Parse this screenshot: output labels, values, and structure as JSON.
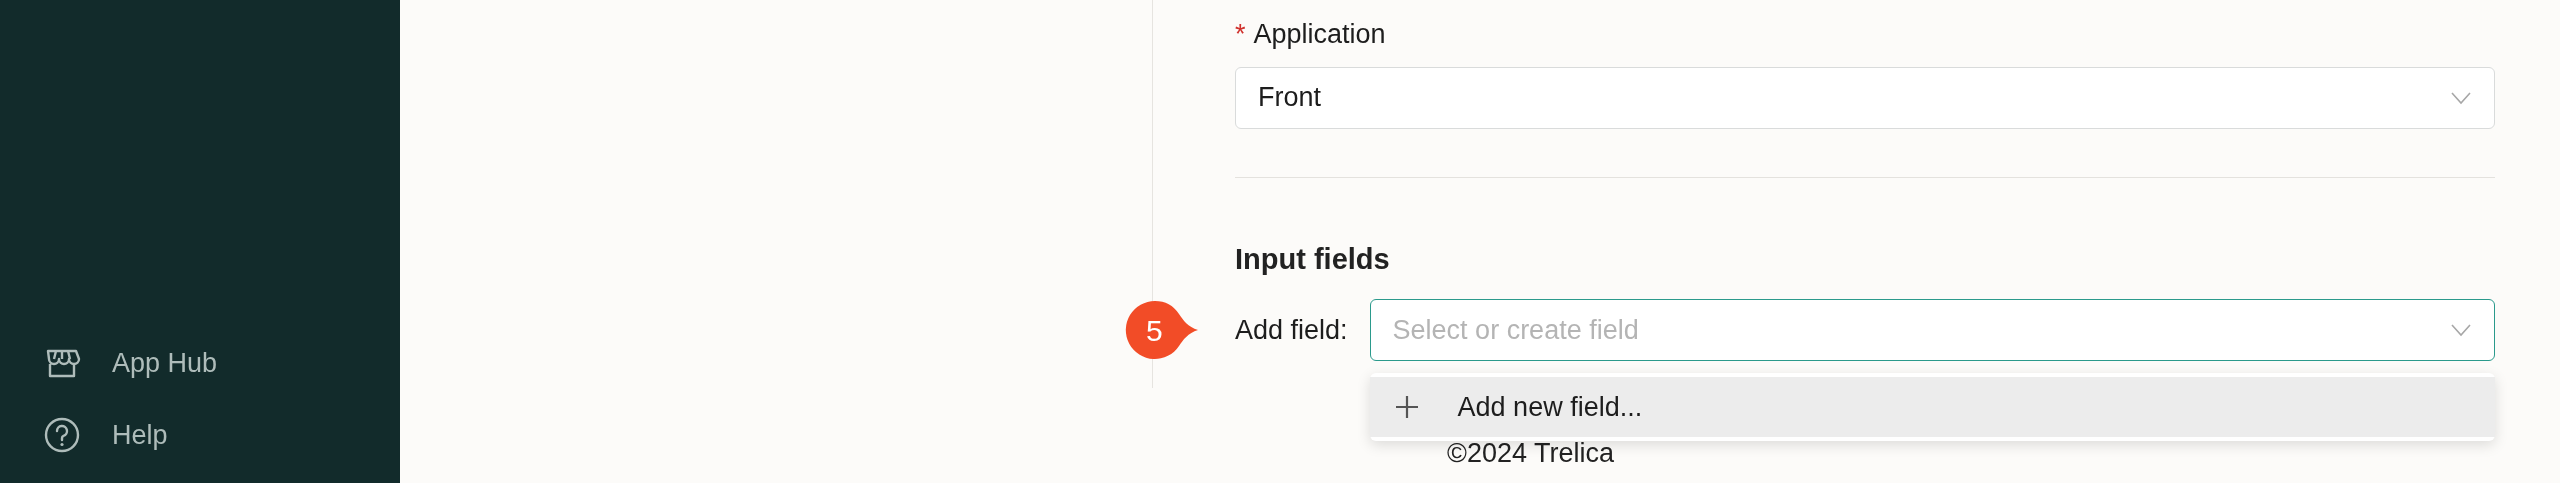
{
  "sidebar": {
    "items": [
      {
        "kind": "store",
        "label": "App Hub"
      },
      {
        "kind": "help",
        "label": "Help"
      }
    ]
  },
  "form": {
    "application": {
      "label": "Application",
      "required": true,
      "required_mark": "*",
      "value": "Front"
    },
    "section_title": "Input fields",
    "add_field": {
      "label": "Add field:",
      "placeholder": "Select or create field",
      "focused": true,
      "callout": "5",
      "menu": [
        {
          "kind": "add",
          "label": "Add new field...",
          "active": true
        }
      ]
    }
  },
  "footer": "©2024 Trelica"
}
